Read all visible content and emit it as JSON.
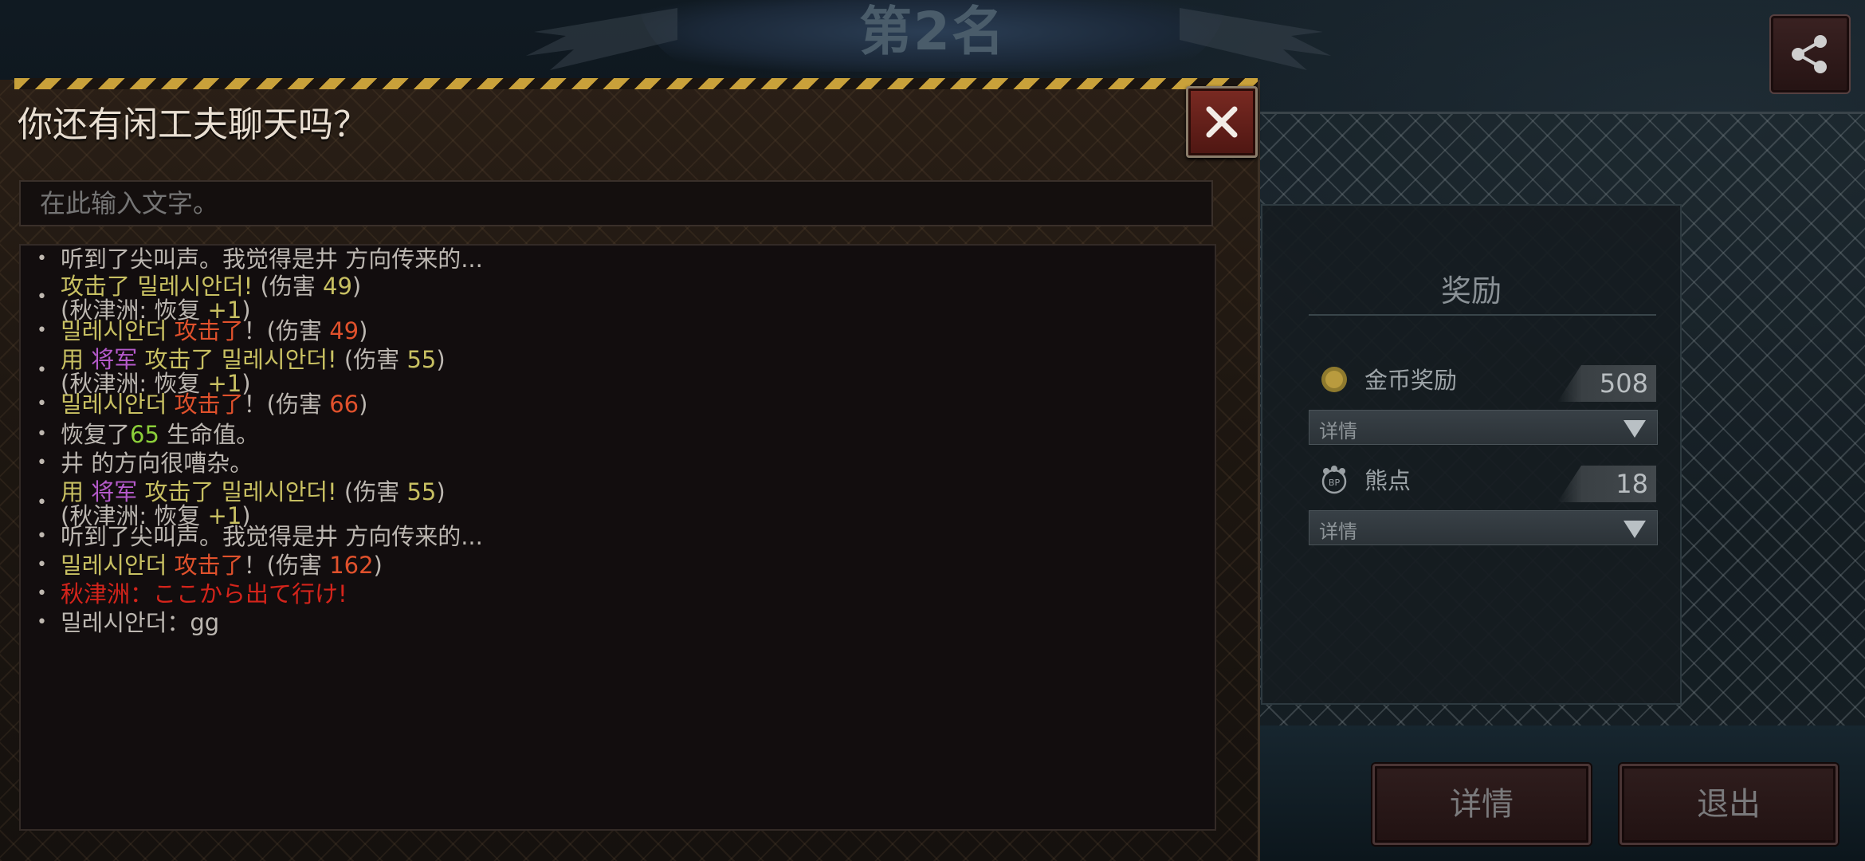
{
  "header": {
    "rank_title": "第2名"
  },
  "chat": {
    "title": "你还有闲工夫聊天吗？",
    "input_placeholder": "在此输入文字。",
    "log": [
      {
        "segments": [
          {
            "text": "听到了尖叫声。我觉得是井 方向传来的...",
            "style": "gry"
          }
        ]
      },
      {
        "segments": [
          {
            "text": "攻击了 ",
            "style": "yel"
          },
          {
            "text": "밀레시안더! ",
            "style": "yel"
          },
          {
            "text": "(伤害 ",
            "style": "gry"
          },
          {
            "text": "49",
            "style": "yel"
          },
          {
            "text": ")",
            "style": "gry"
          }
        ],
        "sub": [
          {
            "text": "(秋津洲: 恢复 ",
            "style": "gry"
          },
          {
            "text": "+1",
            "style": "yel"
          },
          {
            "text": ")",
            "style": "gry"
          }
        ]
      },
      {
        "segments": [
          {
            "text": "밀레시안더  ",
            "style": "yel"
          },
          {
            "text": "攻击了",
            "style": "red"
          },
          {
            "text": "！(伤害 ",
            "style": "gry"
          },
          {
            "text": "49",
            "style": "red"
          },
          {
            "text": ")",
            "style": "gry"
          }
        ]
      },
      {
        "segments": [
          {
            "text": " 用 ",
            "style": "yel"
          },
          {
            "text": "将军 ",
            "style": "pur"
          },
          {
            "text": "攻击了  ",
            "style": "yel"
          },
          {
            "text": "밀레시안더! ",
            "style": "yel"
          },
          {
            "text": "(伤害 ",
            "style": "gry"
          },
          {
            "text": "55",
            "style": "yel"
          },
          {
            "text": ")",
            "style": "gry"
          }
        ],
        "sub": [
          {
            "text": "(秋津洲: 恢复 ",
            "style": "gry"
          },
          {
            "text": "+1",
            "style": "yel"
          },
          {
            "text": ")",
            "style": "gry"
          }
        ]
      },
      {
        "segments": [
          {
            "text": "밀레시안더  ",
            "style": "yel"
          },
          {
            "text": "攻击了",
            "style": "red"
          },
          {
            "text": "！(伤害 ",
            "style": "gry"
          },
          {
            "text": "66",
            "style": "red"
          },
          {
            "text": ")",
            "style": "gry"
          }
        ]
      },
      {
        "segments": [
          {
            "text": "恢复了",
            "style": "gry"
          },
          {
            "text": "65",
            "style": "grn"
          },
          {
            "text": " 生命值。",
            "style": "gry"
          }
        ]
      },
      {
        "segments": [
          {
            "text": "井 的方向很嘈杂。",
            "style": "gry"
          }
        ]
      },
      {
        "segments": [
          {
            "text": " 用 ",
            "style": "yel"
          },
          {
            "text": "将军 ",
            "style": "pur"
          },
          {
            "text": "攻击了  ",
            "style": "yel"
          },
          {
            "text": "밀레시안더! ",
            "style": "yel"
          },
          {
            "text": "(伤害 ",
            "style": "gry"
          },
          {
            "text": "55",
            "style": "yel"
          },
          {
            "text": ")",
            "style": "gry"
          }
        ],
        "sub": [
          {
            "text": "(秋津洲: 恢复 ",
            "style": "gry"
          },
          {
            "text": "+1",
            "style": "yel"
          },
          {
            "text": ")",
            "style": "gry"
          }
        ]
      },
      {
        "segments": [
          {
            "text": "听到了尖叫声。我觉得是井 方向传来的...",
            "style": "gry"
          }
        ]
      },
      {
        "segments": [
          {
            "text": "밀레시안더  ",
            "style": "yel"
          },
          {
            "text": "攻击了",
            "style": "red"
          },
          {
            "text": "！(伤害 ",
            "style": "gry"
          },
          {
            "text": "162",
            "style": "red"
          },
          {
            "text": ")",
            "style": "gry"
          }
        ]
      },
      {
        "segments": [
          {
            "text": "秋津洲：ここから出て行け!",
            "style": "alert"
          }
        ]
      },
      {
        "segments": [
          {
            "text": "밀레시안더：gg",
            "style": "gry"
          }
        ]
      }
    ]
  },
  "rewards": {
    "title": "奖励",
    "items": [
      {
        "icon": "gold-coin-icon",
        "label": "金币奖励",
        "value": "508",
        "detail_label": "详情"
      },
      {
        "icon": "bear-point-icon",
        "label": "熊点",
        "value": "18",
        "detail_label": "详情"
      }
    ]
  },
  "buttons": {
    "details_label": "详情",
    "exit_label": "退出"
  },
  "colors": {
    "hazard_yellow": "#c9a13a",
    "close_red": "#7a2a22",
    "damage_red": "#e0512c",
    "highlight_yellow": "#c8c062",
    "general_purple": "#b55acb",
    "heal_green": "#8ccf3a",
    "alert_red": "#d4241b"
  }
}
